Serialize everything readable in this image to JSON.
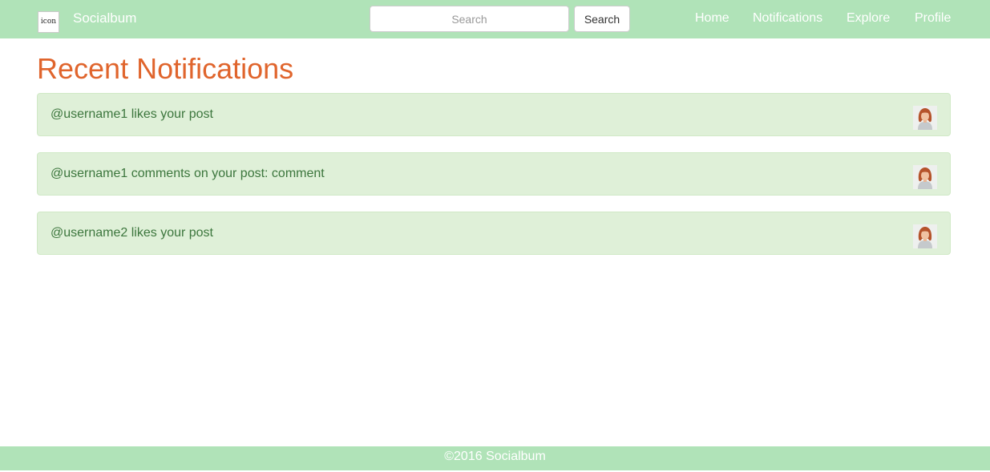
{
  "brand": {
    "logo_text": "icon",
    "name": "Socialbum"
  },
  "search": {
    "placeholder": "Search",
    "button_label": "Search"
  },
  "nav": {
    "home": "Home",
    "notifications": "Notifications",
    "explore": "Explore",
    "profile": "Profile"
  },
  "page": {
    "title": "Recent Notifications"
  },
  "notifications": [
    {
      "text": "@username1 likes your post",
      "avatar": "user-avatar-photo"
    },
    {
      "text": "@username1 comments on your post: comment",
      "avatar": "user-avatar-photo"
    },
    {
      "text": "@username2 likes your post",
      "avatar": "user-avatar-photo"
    }
  ],
  "footer": {
    "text": "©2016 Socialbum"
  },
  "colors": {
    "navbar_bg": "#b0e3b8",
    "title": "#e0652d",
    "alert_bg": "#dff0d8",
    "alert_border": "#d0e9c6",
    "alert_text": "#3c763d"
  }
}
